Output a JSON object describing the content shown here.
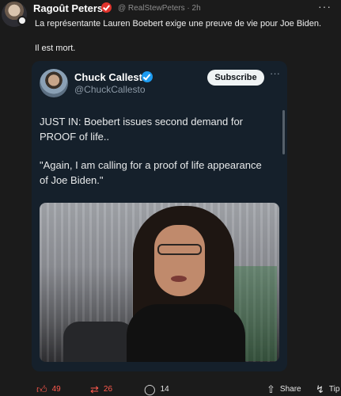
{
  "post": {
    "author": "Ragoût Peters",
    "handle": "@ RealStewPeters · 2h",
    "more": "···",
    "text_line_1": "La représentante Lauren Boebert exige une preuve de vie pour Joe Biden.",
    "text_line_2": "Il est mort."
  },
  "embed": {
    "name": "Chuck Callesto",
    "handle": "@ChuckCallesto",
    "subscribe_label": "Subscribe",
    "more": "···",
    "lines": [
      "JUST IN: Boebert issues second demand for",
      "PROOF of life..",
      "\"Again, I am calling for a proof of life appearance",
      "of Joe Biden.\""
    ]
  },
  "actions": {
    "like_count": "49",
    "repost_count": "26",
    "comment_count": "14",
    "share_label": "Share",
    "tip_label": "Tip"
  },
  "colors": {
    "background": "#1b1b1b",
    "embed_background": "#15202b",
    "like_red": "#ff5a4e",
    "twitter_blue": "#1d9bf0"
  },
  "icons": {
    "like": "thumbs-up-icon",
    "repost": "repost-icon",
    "comment": "comment-icon",
    "share": "share-icon",
    "tip": "lightning-icon"
  }
}
